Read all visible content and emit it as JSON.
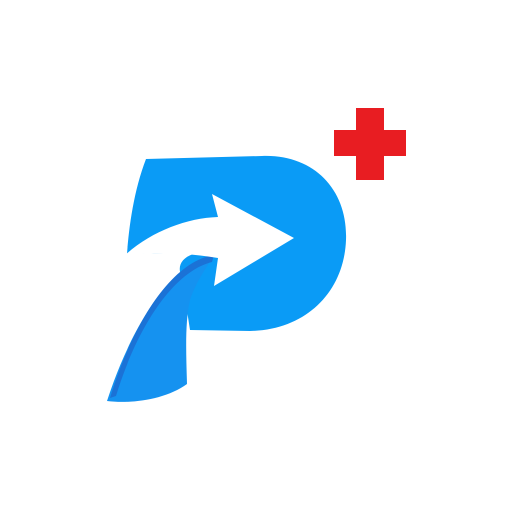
{
  "app_icon": {
    "icon_name": "app-logo-icon",
    "description_icon": "p-arrow-logo-icon",
    "badge_icon": "plus-badge-icon",
    "colors": {
      "background": "#ffffff",
      "p_primary": "#0a9bf6",
      "p_shadow": "#1b72d6",
      "p_tail_light": "#1592f0",
      "arrow_white": "#ffffff",
      "badge_red": "#e81d22"
    }
  }
}
